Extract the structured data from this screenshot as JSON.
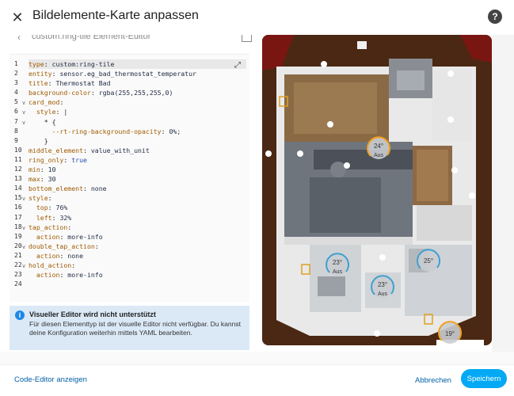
{
  "dialog": {
    "title": "Bildelemente-Karte anpassen",
    "close_icon": "close-icon",
    "help_icon": "help-icon"
  },
  "subheader": {
    "title": "custom:ring-tile Element-Editor"
  },
  "editor": {
    "lines": [
      {
        "n": "1",
        "fold": "",
        "text": "type: custom:ring-tile"
      },
      {
        "n": "2",
        "fold": "",
        "text": "entity: sensor.eg_bad_thermostat_temperatur"
      },
      {
        "n": "3",
        "fold": "",
        "text": "title: Thermostat Bad"
      },
      {
        "n": "4",
        "fold": "",
        "text": "background-color: rgba(255,255,255,0)"
      },
      {
        "n": "5",
        "fold": "v",
        "text": "card_mod:"
      },
      {
        "n": "6",
        "fold": "v",
        "text": "  style: |"
      },
      {
        "n": "7",
        "fold": "v",
        "text": "    * {"
      },
      {
        "n": "8",
        "fold": "",
        "text": "      --rt-ring-background-opacity: 0%;"
      },
      {
        "n": "9",
        "fold": "",
        "text": "    }"
      },
      {
        "n": "10",
        "fold": "",
        "text": "middle_element: value_with_unit"
      },
      {
        "n": "11",
        "fold": "",
        "text": "ring_only: true"
      },
      {
        "n": "12",
        "fold": "",
        "text": "min: 10"
      },
      {
        "n": "13",
        "fold": "",
        "text": "max: 30"
      },
      {
        "n": "14",
        "fold": "",
        "text": "bottom_element: none"
      },
      {
        "n": "15",
        "fold": "v",
        "text": "style:"
      },
      {
        "n": "16",
        "fold": "",
        "text": "  top: 76%"
      },
      {
        "n": "17",
        "fold": "",
        "text": "  left: 32%"
      },
      {
        "n": "18",
        "fold": "v",
        "text": "tap_action:"
      },
      {
        "n": "19",
        "fold": "",
        "text": "  action: more-info"
      },
      {
        "n": "20",
        "fold": "v",
        "text": "double_tap_action:"
      },
      {
        "n": "21",
        "fold": "",
        "text": "  action: none"
      },
      {
        "n": "22",
        "fold": "v",
        "text": "hold_action:"
      },
      {
        "n": "23",
        "fold": "",
        "text": "  action: more-info"
      },
      {
        "n": "24",
        "fold": "",
        "text": ""
      }
    ]
  },
  "info": {
    "title": "Visueller Editor wird nicht unterstützt",
    "body": "Für diesen Elementtyp ist der visuelle Editor nicht verfügbar. Du kannst deine Konfiguration weiterhin mittels YAML bearbeiten."
  },
  "floorplan": {
    "thermostats": [
      {
        "value": "24°",
        "label": "Aus"
      },
      {
        "value": "23°",
        "label": "Aus"
      },
      {
        "value": "23°",
        "label": "Aus"
      },
      {
        "value": "25°",
        "label": ""
      },
      {
        "value": "19°",
        "label": ""
      }
    ]
  },
  "footer": {
    "code_editor_label": "Code-Editor anzeigen",
    "cancel_label": "Abbrechen",
    "save_label": "Speichern"
  }
}
